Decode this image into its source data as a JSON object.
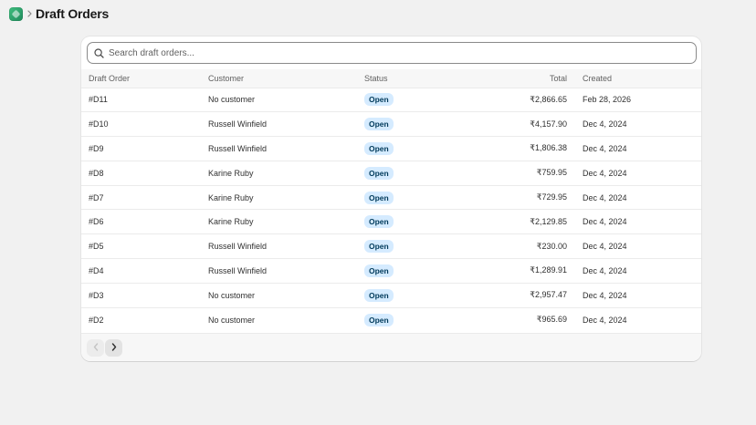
{
  "header": {
    "title": "Draft Orders"
  },
  "search": {
    "placeholder": "Search draft orders..."
  },
  "table": {
    "columns": [
      "Draft Order",
      "Customer",
      "Status",
      "Total",
      "Created"
    ],
    "rows": [
      {
        "order": "#D11",
        "customer": "No customer",
        "status": "Open",
        "total": "₹2,866.65",
        "created": "Feb 28, 2026"
      },
      {
        "order": "#D10",
        "customer": "Russell Winfield",
        "status": "Open",
        "total": "₹4,157.90",
        "created": "Dec 4, 2024"
      },
      {
        "order": "#D9",
        "customer": "Russell Winfield",
        "status": "Open",
        "total": "₹1,806.38",
        "created": "Dec 4, 2024"
      },
      {
        "order": "#D8",
        "customer": "Karine Ruby",
        "status": "Open",
        "total": "₹759.95",
        "created": "Dec 4, 2024"
      },
      {
        "order": "#D7",
        "customer": "Karine Ruby",
        "status": "Open",
        "total": "₹729.95",
        "created": "Dec 4, 2024"
      },
      {
        "order": "#D6",
        "customer": "Karine Ruby",
        "status": "Open",
        "total": "₹2,129.85",
        "created": "Dec 4, 2024"
      },
      {
        "order": "#D5",
        "customer": "Russell Winfield",
        "status": "Open",
        "total": "₹230.00",
        "created": "Dec 4, 2024"
      },
      {
        "order": "#D4",
        "customer": "Russell Winfield",
        "status": "Open",
        "total": "₹1,289.91",
        "created": "Dec 4, 2024"
      },
      {
        "order": "#D3",
        "customer": "No customer",
        "status": "Open",
        "total": "₹2,957.47",
        "created": "Dec 4, 2024"
      },
      {
        "order": "#D2",
        "customer": "No customer",
        "status": "Open",
        "total": "₹965.69",
        "created": "Dec 4, 2024"
      }
    ]
  },
  "icons": {
    "logo": "app-logo-icon",
    "breadcrumb": "chevron-right-icon",
    "search": "search-icon",
    "prev": "chevron-left-icon",
    "next": "chevron-right-icon"
  },
  "colors": {
    "badge_bg": "#d5ebff",
    "badge_text": "#003a5a",
    "logo": "#2fa56d"
  }
}
